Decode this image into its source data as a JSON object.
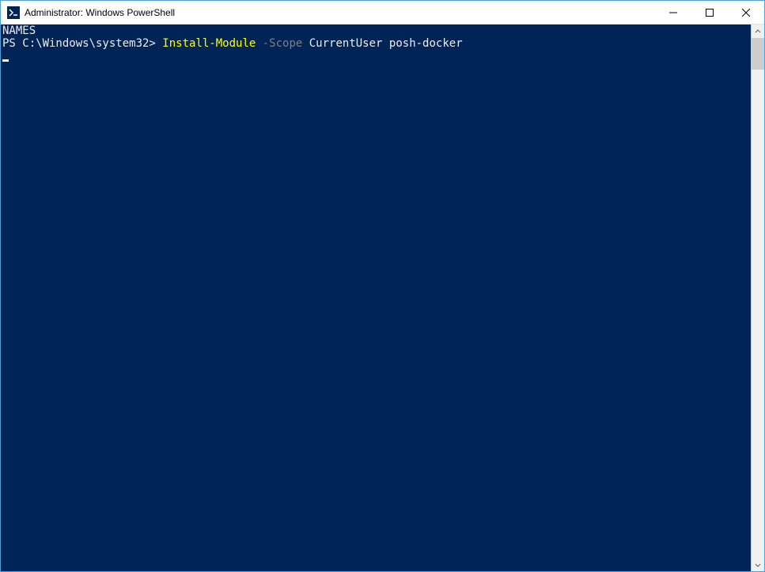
{
  "window": {
    "title": "Administrator: Windows PowerShell"
  },
  "console": {
    "line1": "NAMES",
    "prompt": "PS C:\\Windows\\system32> ",
    "command": "Install-Module",
    "param_flag": " -Scope",
    "param_rest": " CurrentUser posh-docker"
  },
  "colors": {
    "console_bg": "#012456",
    "text_white": "#eeedf0",
    "text_yellow": "#ffff00",
    "text_gray": "#808080"
  }
}
